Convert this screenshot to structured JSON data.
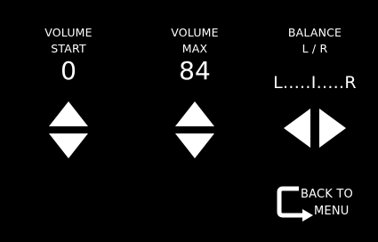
{
  "colors": {
    "background": "#000000",
    "foreground": "#ffffff"
  },
  "volume_start": {
    "label_line1": "VOLUME",
    "label_line2": "START",
    "value": "0",
    "up_icon": "triangle-up-icon",
    "down_icon": "triangle-down-icon"
  },
  "volume_max": {
    "label_line1": "VOLUME",
    "label_line2": "MAX",
    "value": "84",
    "up_icon": "triangle-up-icon",
    "down_icon": "triangle-down-icon"
  },
  "balance": {
    "label_line1": "BALANCE",
    "label_line2": "L / R",
    "value": "L.....I.....R",
    "left_icon": "triangle-left-icon",
    "right_icon": "triangle-right-icon"
  },
  "back_button": {
    "line1": "BACK TO",
    "line2": "MENU",
    "icon": "return-arrow-icon"
  }
}
